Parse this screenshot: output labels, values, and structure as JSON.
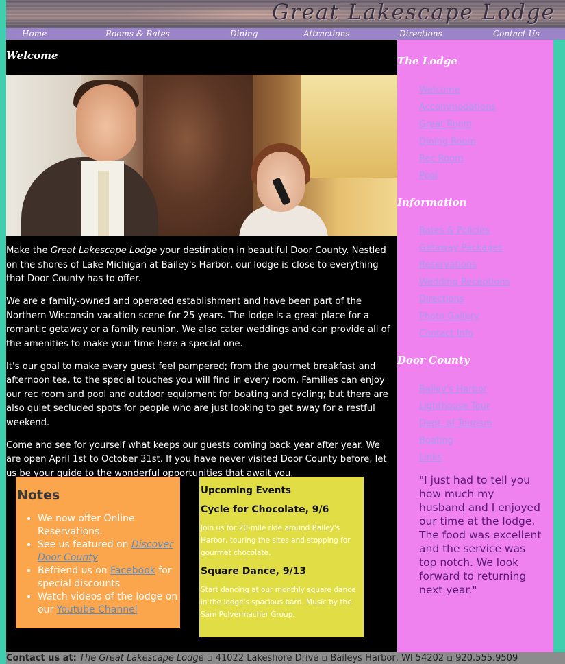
{
  "header": {
    "title": "Great Lakescape Lodge"
  },
  "nav": {
    "items": [
      {
        "label": "Home"
      },
      {
        "label": "Rooms & Rates"
      },
      {
        "label": "Dining"
      },
      {
        "label": "Attractions"
      },
      {
        "label": "Directions"
      },
      {
        "label": "Contact Us"
      }
    ]
  },
  "main": {
    "heading": "Welcome",
    "intro": {
      "p1_pre": "Make the ",
      "p1_name": "Great Lakescape Lodge",
      "p1_post": " your destination in beautiful Door County. Nestled on the shores of Lake Michigan at Bailey's Harbor, our lodge is close to everything that Door County has to offer.",
      "p2": "We are a family-owned and operated establishment and have been part of the Northern Wisconsin vacation scene for 25 years. The lodge is a great place for a romantic getaway or a family reunion. We also cater weddings and can provide all of the amenities to make your time here a special one.",
      "p3": "It's our goal to make every guest feel pampered; from the gourmet breakfast and afternoon tea, to the special touches you will find in every room. Families can enjoy our rec room and pool and outdoor equipment for boating and cycling; but there are also quiet secluded spots for people who are just looking to get away for a restful weekend.",
      "p4": "Come and see for yourself what keeps our guests coming back year after year. We are open April 1st to October 31st. If you have never visited Door County before, let us be your guide to the wonderful opportunities that await you."
    },
    "notes": {
      "heading": "Notes",
      "item1": "We now offer Online Reservations.",
      "item2_pre": "See us featured on ",
      "item2_link": "Discover Door County",
      "item3_pre": "Befriend us on ",
      "item3_link": "Facebook",
      "item3_post": " for special discounts",
      "item4_pre": "Watch videos of the lodge on our ",
      "item4_link": "Youtube Channel"
    },
    "events": {
      "heading": "Upcoming Events",
      "event1_title": "Cycle for Chocolate, 9/6",
      "event1_desc": "Join us for 20-mile ride around Bailey's Harbor, touring the sites and stopping for gourmet chocolate.",
      "event2_title": "Square Dance, 9/13",
      "event2_desc": "Start dancing at our monthly square dance in the lodge's spacious barn. Music by the Sam Pulvermacher Group."
    }
  },
  "sidebar": {
    "lodge": {
      "heading": "The Lodge",
      "links": [
        "Welcome",
        "Accommodations",
        "Great Room",
        "Dining Room",
        "Rec Room",
        "Pool"
      ]
    },
    "information": {
      "heading": "Information",
      "links": [
        "Rates & Policies",
        "Getaway Packages",
        "Reservations",
        "Wedding Receptions",
        "Directions",
        "Photo Gallery",
        "Contact Info"
      ]
    },
    "door_county": {
      "heading": "Door County",
      "links": [
        "Bailey's Harbor",
        "Lighthouse Tour",
        "Dept. of Tourism",
        "Boating",
        "Links"
      ]
    },
    "quote": "\"I just had to tell you how much my husband and I enjoyed our time at the lodge. The food was excellent and the service was top notch. We look forward to returning next year.\""
  },
  "footer": {
    "label": "Contact us at:",
    "name": "The Great Lakescape Lodge",
    "address": " ▫ 41022 Lakeshore Drive ▫ Baileys Harbor, WI 54202 ▫ 920.555.9509"
  },
  "colors": {
    "page_bg": "#3fcfae",
    "nav_bg": "#9c84c9",
    "sidebar_bg": "#ef82ef",
    "notes_bg": "#fba64d",
    "events_bg": "#e0dd45",
    "link": "#a79bf2",
    "quote": "#5a1a74",
    "footer_bg": "#8c8c8c"
  }
}
